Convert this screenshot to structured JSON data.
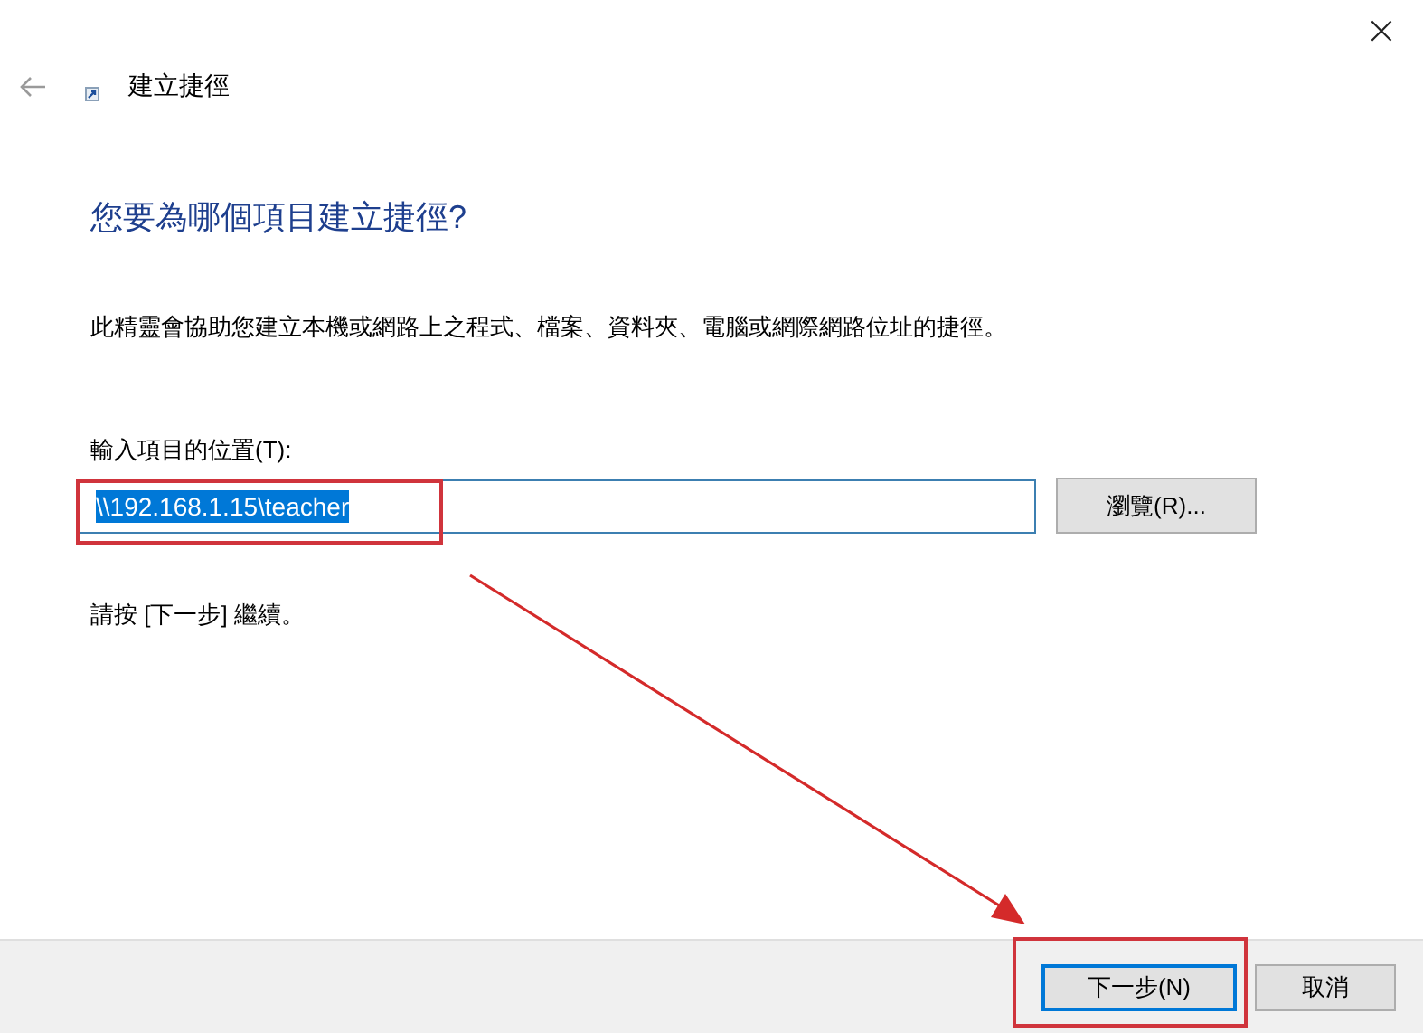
{
  "window": {
    "title": "建立捷徑",
    "close": "×"
  },
  "heading": "您要為哪個項目建立捷徑?",
  "description": "此精靈會協助您建立本機或網路上之程式、檔案、資料夾、電腦或網際網路位址的捷徑。",
  "location": {
    "label": "輸入項目的位置(T):",
    "value": "\\\\192.168.1.15\\teacher",
    "text_selected": true,
    "browse_button": "瀏覽(R)..."
  },
  "hint": "請按 [下一步] 繼續。",
  "buttons": [
    {
      "label": "下一步(N)",
      "default": true
    },
    {
      "label": "取消",
      "default": false
    }
  ]
}
